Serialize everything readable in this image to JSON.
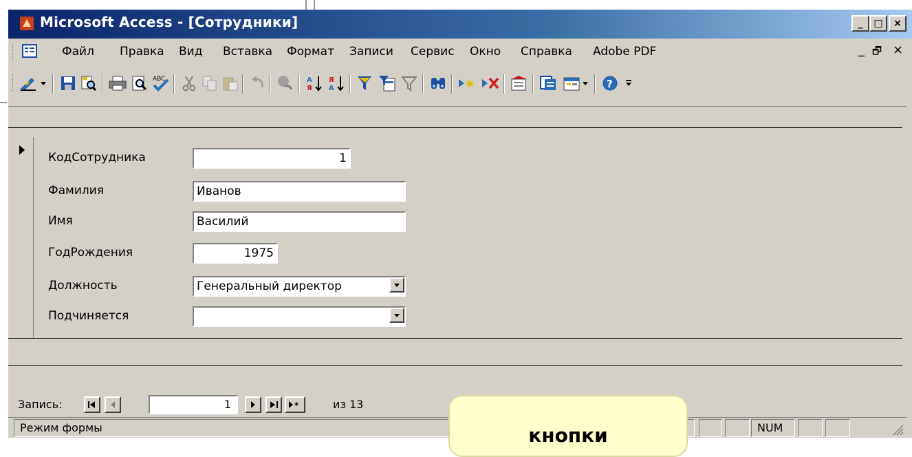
{
  "window": {
    "title": "Microsoft Access - [Сотрудники]",
    "controls": [
      "_",
      "□",
      "×"
    ]
  },
  "menu": {
    "items": [
      "Файл",
      "Правка",
      "Вид",
      "Вставка",
      "Формат",
      "Записи",
      "Сервис",
      "Окно",
      "Справка",
      "Adobe PDF"
    ],
    "mdi_controls": [
      "_",
      "🗗",
      "×"
    ]
  },
  "toolbar": {
    "icons": [
      "design-view-icon",
      "save-icon",
      "file-search-icon",
      "print-icon",
      "print-preview-icon",
      "spelling-icon",
      "cut-icon",
      "copy-icon",
      "paste-icon",
      "undo-icon",
      "insert-hyperlink-icon",
      "sort-ascending-icon",
      "sort-descending-icon",
      "filter-by-selection-icon",
      "filter-by-form-icon",
      "apply-filter-icon",
      "find-icon",
      "new-record-icon",
      "delete-record-icon",
      "properties-icon",
      "database-window-icon",
      "new-object-icon",
      "help-icon"
    ]
  },
  "form": {
    "fields": [
      {
        "label": "КодСотрудника",
        "value": "1"
      },
      {
        "label": "Фамилия",
        "value": "Иванов"
      },
      {
        "label": "Имя",
        "value": "Василий"
      },
      {
        "label": "ГодРождения",
        "value": "1975"
      },
      {
        "label": "Должность",
        "value": "Генеральный директор"
      },
      {
        "label": "Подчиняется",
        "value": ""
      }
    ]
  },
  "navigation": {
    "label": "Запись:",
    "current": "1",
    "of_text": "из 13"
  },
  "status": {
    "mode": "Режим формы",
    "num": "NUM"
  },
  "callout": {
    "text": "кнопки"
  },
  "colors": {
    "face": "#d4d0c8",
    "titlebar_start": "#0a246a",
    "titlebar_end": "#a6caf0",
    "callout_bg": "#ffffcc"
  }
}
